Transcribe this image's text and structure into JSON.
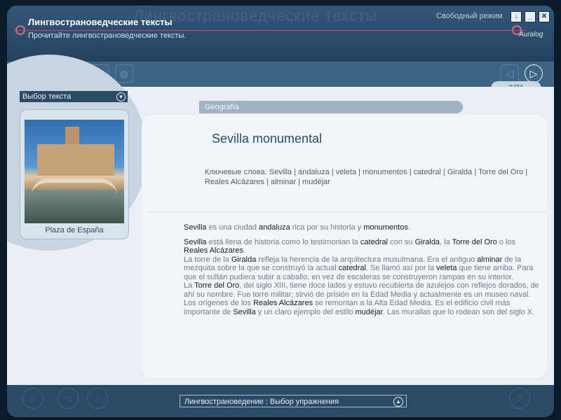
{
  "window": {
    "title": "Лингвострановедческие тексты",
    "subtitle": "Прочитайте лингвострановедческие тексты.",
    "mode": "Свободный режим",
    "logo_text": "Auralog",
    "buttons": {
      "download": "↓",
      "minimize": "_",
      "close": "✕"
    }
  },
  "toolbar": {
    "page": "2/71",
    "icons": [
      "home-icon",
      "flag-icon",
      "video-icon",
      "record-icon",
      "globe-icon",
      "back-icon",
      "forward-icon"
    ]
  },
  "left_panel": {
    "select_label": "Выбор текста",
    "photo_caption": "Plaza de España"
  },
  "content": {
    "category": "Geografía",
    "heading": "Sevilla monumental",
    "keywords_label": "Ключевые слова:",
    "keywords": [
      "Sevilla",
      "andaluza",
      "veleta",
      "monumentos",
      "catedral",
      "Giralda",
      "Torre del Oro",
      "Reales Alcázares",
      "alminar",
      "mudéjar"
    ],
    "para1": [
      {
        "t": "Sevilla",
        "kw": true
      },
      {
        "t": " es una ciudad ",
        "kw": false
      },
      {
        "t": "andaluza",
        "kw": true
      },
      {
        "t": " rica por su historia y ",
        "kw": false
      },
      {
        "t": "monumentos",
        "kw": true
      },
      {
        "t": ".",
        "kw": false
      }
    ],
    "para2": [
      {
        "t": "Sevilla",
        "kw": true
      },
      {
        "t": " está llena de historia como lo testimonian la ",
        "kw": false
      },
      {
        "t": "catedral",
        "kw": true
      },
      {
        "t": " con su ",
        "kw": false
      },
      {
        "t": "Giralda",
        "kw": true
      },
      {
        "t": ", la ",
        "kw": false
      },
      {
        "t": "Torre del Oro",
        "kw": true
      },
      {
        "t": " o los ",
        "kw": false
      },
      {
        "t": "Reales Alcázares",
        "kw": true
      },
      {
        "t": ".",
        "kw": false
      }
    ],
    "para3": [
      {
        "t": "La torre de la ",
        "kw": false
      },
      {
        "t": "Giralda",
        "kw": true
      },
      {
        "t": " refleja la herencia de la arquitectura musulmana. Era el antiguo ",
        "kw": false
      },
      {
        "t": "alminar",
        "kw": true
      },
      {
        "t": " de la mezquita sobre la que se construyó la actual ",
        "kw": false
      },
      {
        "t": "catedral",
        "kw": true
      },
      {
        "t": ". Se llamó así por la ",
        "kw": false
      },
      {
        "t": "veleta",
        "kw": true
      },
      {
        "t": " que tiene arriba. Para que el sultán pudiera subir a caballo, en vez de escaleras se construyeron rampas en su interior.",
        "kw": false
      }
    ],
    "para4": [
      {
        "t": "La ",
        "kw": false
      },
      {
        "t": "Torre del Oro",
        "kw": true
      },
      {
        "t": ", del siglo XIII, tiene doce lados y estuvo recubierta de azulejos con reflejos dorados, de ahí su nombre. Fue torre militar; sirvió de prisión en la Edad Media y actualmente es un museo naval.",
        "kw": false
      }
    ],
    "para5": [
      {
        "t": "Los orígenes de los ",
        "kw": false
      },
      {
        "t": "Reales Alcázares",
        "kw": true
      },
      {
        "t": " se remontan a la Alta Edad Media. Es el edificio civil más importante de ",
        "kw": false
      },
      {
        "t": "Sevilla",
        "kw": true
      },
      {
        "t": " y un claro ejemplo del estilo ",
        "kw": false
      },
      {
        "t": "mudéjar",
        "kw": true
      },
      {
        "t": ". Las murallas que lo rodean son del siglo X.",
        "kw": false
      }
    ]
  },
  "footer": {
    "select_label": "Лингвострановедение : Выбор упражнения",
    "icons": [
      "house-icon",
      "left-arrow-icon",
      "sound-icon",
      "help-icon"
    ]
  },
  "colors": {
    "frame": "#2b4a66",
    "panel": "#e9eff5",
    "accent_line": "#c74a5a"
  }
}
